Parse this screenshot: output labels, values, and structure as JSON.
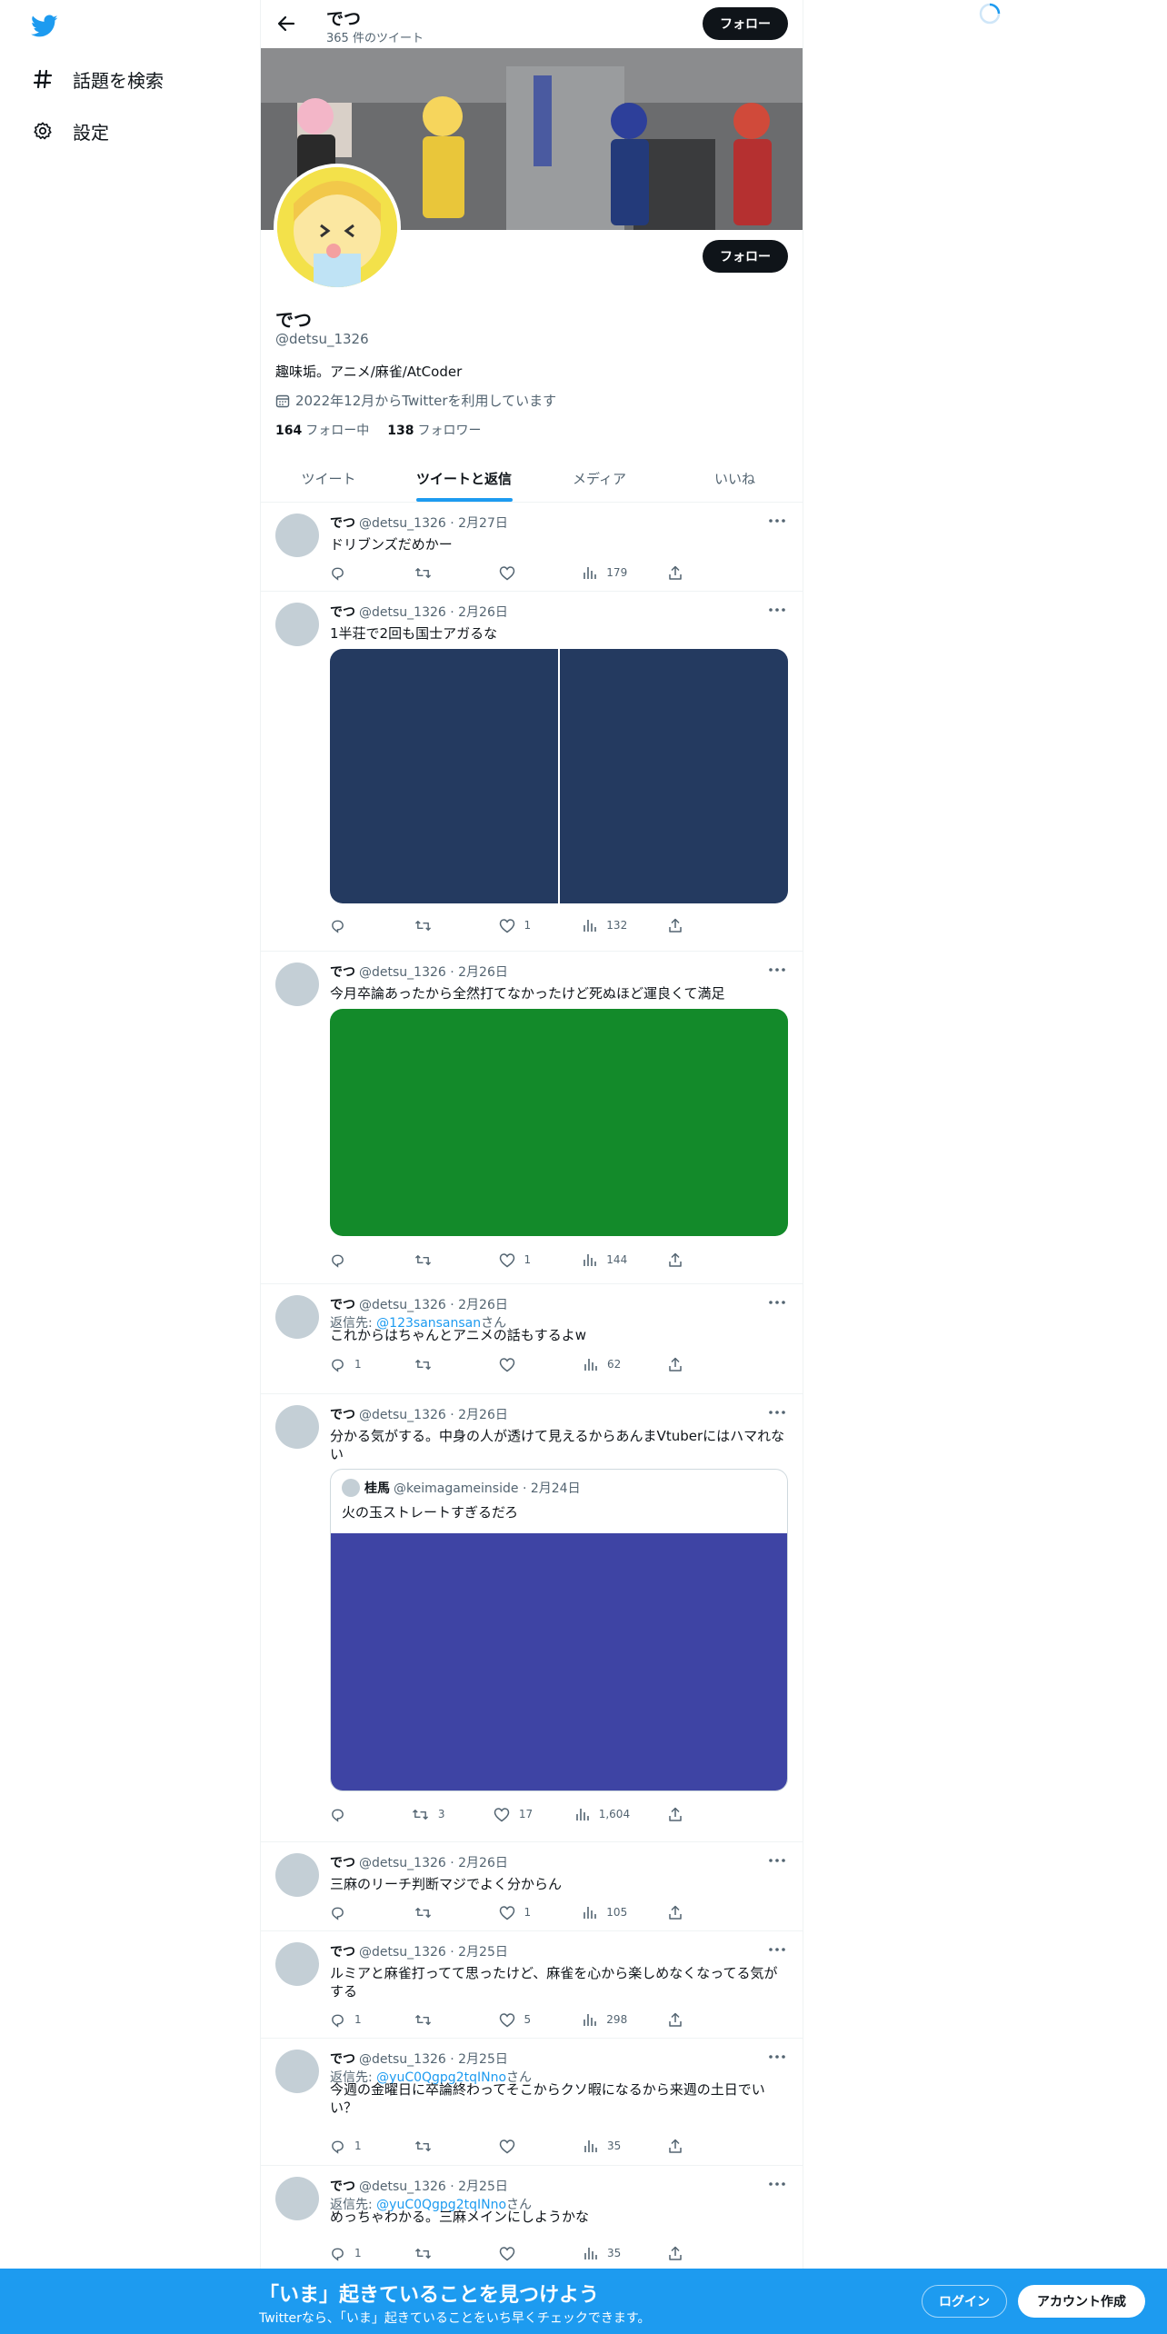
{
  "colors": {
    "accent": "#1d9bf0",
    "text": "#0f1419",
    "muted": "#536471",
    "border": "#eff3f4",
    "media_navy": "#243a60",
    "media_green": "#138a2a",
    "media_indigo": "#3e44a4"
  },
  "nav": {
    "logo_icon": "twitter-bird-icon",
    "items": [
      {
        "icon": "hashtag-icon",
        "label": "話題を検索"
      },
      {
        "icon": "gear-icon",
        "label": "設定"
      }
    ]
  },
  "header": {
    "name": "でつ",
    "tweet_count": "365 件のツイート",
    "follow_label": "フォロー"
  },
  "profile": {
    "name": "でつ",
    "handle": "@detsu_1326",
    "bio": "趣味垢。アニメ/麻雀/AtCoder",
    "joined": "2022年12月からTwitterを利用しています",
    "following_count": "164",
    "following_label": "フォロー中",
    "followers_count": "138",
    "followers_label": "フォロワー",
    "follow_label": "フォロー"
  },
  "tabs": [
    "ツイート",
    "ツイートと返信",
    "メディア",
    "いいね"
  ],
  "tweets": [
    {
      "name": "でつ",
      "meta": "@detsu_1326 · 2月27日",
      "text": "ドリブンズだめかー",
      "replies": "",
      "retweets": "",
      "likes": "",
      "views": "179"
    },
    {
      "name": "でつ",
      "meta": "@detsu_1326 · 2月26日",
      "text": "1半荘で2回も国士アガるな",
      "replies": "",
      "retweets": "",
      "likes": "1",
      "views": "132"
    },
    {
      "name": "でつ",
      "meta": "@detsu_1326 · 2月26日",
      "text": "今月卒論あったから全然打てなかったけど死ぬほど運良くて満足",
      "replies": "",
      "retweets": "",
      "likes": "1",
      "views": "144"
    },
    {
      "name": "でつ",
      "meta": "@detsu_1326 · 2月26日",
      "reply_prefix": "返信先: ",
      "reply_to": "@123sansansan",
      "reply_suffix": "さん",
      "text": "これからはちゃんとアニメの話もするよw",
      "replies": "1",
      "retweets": "",
      "likes": "",
      "views": "62"
    },
    {
      "name": "でつ",
      "meta": "@detsu_1326 · 2月26日",
      "text": "分かる気がする。中身の人が透けて見えるからあんまVtuberにはハマれない",
      "quote": {
        "name": "桂馬",
        "meta": "@keimagameinside · 2月24日",
        "text": "火の玉ストレートすぎるだろ"
      },
      "replies": "",
      "retweets": "3",
      "likes": "17",
      "views": "1,604"
    },
    {
      "name": "でつ",
      "meta": "@detsu_1326 · 2月26日",
      "text": "三麻のリーチ判断マジでよく分からん",
      "replies": "",
      "retweets": "",
      "likes": "1",
      "views": "105"
    },
    {
      "name": "でつ",
      "meta": "@detsu_1326 · 2月25日",
      "text": "ルミアと麻雀打ってて思ったけど、麻雀を心から楽しめなくなってる気がする",
      "replies": "1",
      "retweets": "",
      "likes": "5",
      "views": "298"
    },
    {
      "name": "でつ",
      "meta": "@detsu_1326 · 2月25日",
      "reply_prefix": "返信先: ",
      "reply_to": "@yuC0Qgpg2tqINno",
      "reply_suffix": "さん",
      "text": "今週の金曜日に卒論終わってそこからクソ暇になるから来週の土日でいい？",
      "replies": "1",
      "retweets": "",
      "likes": "",
      "views": "35"
    },
    {
      "name": "でつ",
      "meta": "@detsu_1326 · 2月25日",
      "reply_prefix": "返信先: ",
      "reply_to": "@yuC0Qgpg2tqINno",
      "reply_suffix": "さん",
      "text": "めっちゃわかる。三麻メインにしようかな",
      "replies": "1",
      "retweets": "",
      "likes": "",
      "views": "35"
    }
  ],
  "bottom": {
    "title": "「いま」起きていることを見つけよう",
    "subtitle": "Twitterなら、「いま」起きていることをいち早くチェックできます。",
    "login": "ログイン",
    "signup": "アカウント作成"
  }
}
